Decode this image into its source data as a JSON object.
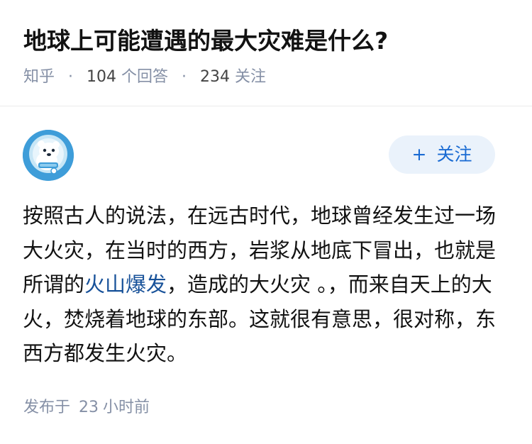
{
  "question": {
    "title": "地球上可能遭遇的最大灾难是什么?",
    "source": "知乎",
    "answer_count": "104",
    "answer_count_label": "个回答",
    "follower_count": "234",
    "follower_label": "关注",
    "separator": "·"
  },
  "author": {
    "avatar_icon": "polar-bear-astronaut-icon",
    "name": "",
    "follow_plus": "+",
    "follow_label": "关注"
  },
  "answer": {
    "text_before_link": "按照古人的说法，在远古时代，地球曾经发生过一场大火灾，在当时的西方，岩浆从地底下冒出，也就是所谓的",
    "link_text": "火山爆发",
    "text_after_link": "，造成的大火灾 。，而来自天上的大火，焚烧着地球的东部。这就很有意思，很对称，东西方都发生火灾。"
  },
  "footer": {
    "published_prefix": "发布于",
    "published_value": "23",
    "published_suffix": "小时前"
  },
  "colors": {
    "link": "#175199",
    "follow_button_bg": "#eaf2fb",
    "follow_button_text": "#1a6bd3",
    "meta_gray": "#8590a6",
    "avatar_bg": "#3e9dd9"
  }
}
